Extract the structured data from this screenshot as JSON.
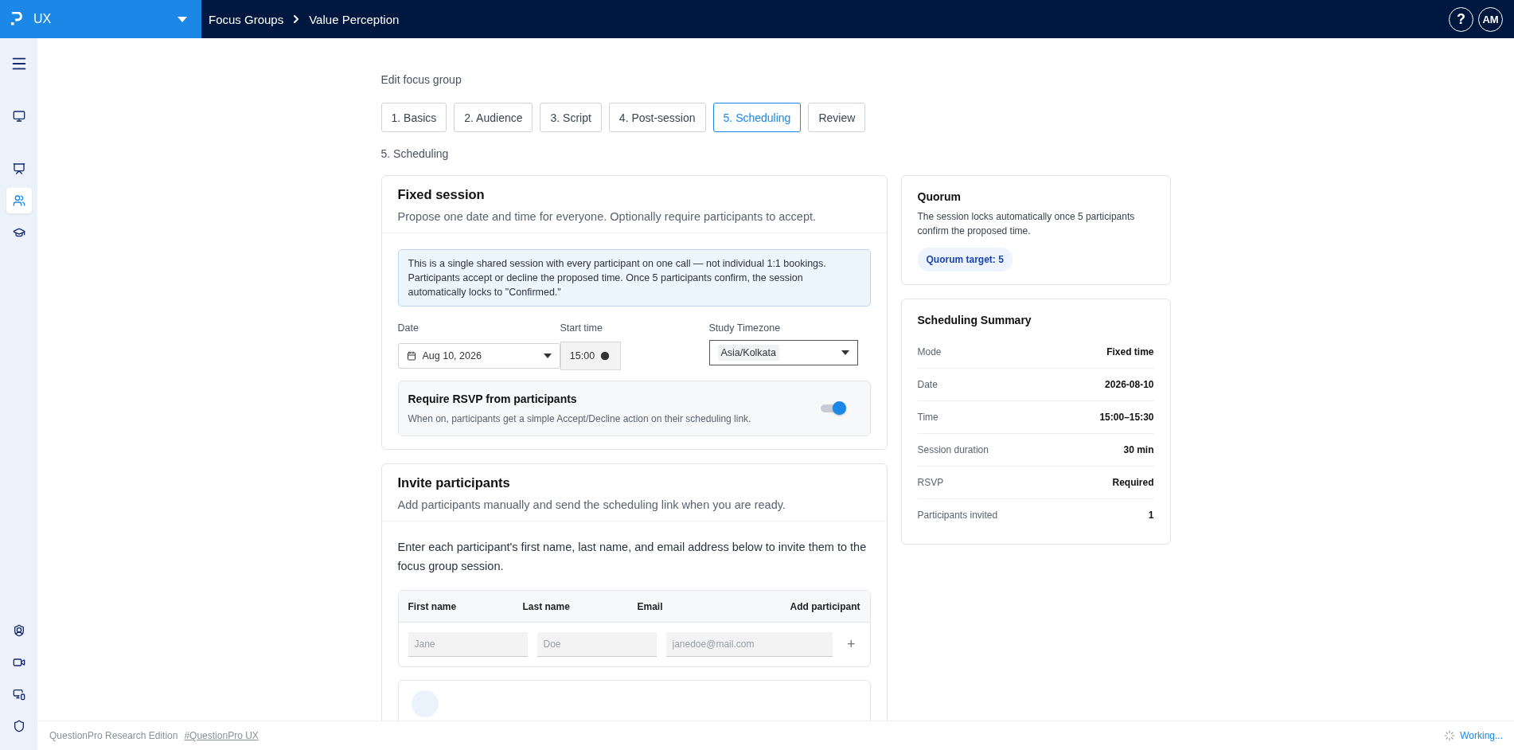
{
  "top_bar": {
    "workspace": "UX",
    "breadcrumb": [
      "Focus Groups",
      "Value Perception"
    ],
    "avatar": "AM",
    "help": "?"
  },
  "sidebar": {
    "items": [
      {
        "selected": false
      },
      {
        "selected": false
      },
      {
        "selected": true
      },
      {
        "selected": false
      }
    ],
    "bottom_items": [
      {
        "selected": false
      },
      {
        "selected": false
      },
      {
        "selected": false
      },
      {
        "selected": false
      }
    ]
  },
  "page_title": "Edit focus group",
  "steps": [
    {
      "label": "1. Basics",
      "selected": false
    },
    {
      "label": "2. Audience",
      "selected": false
    },
    {
      "label": "3. Script",
      "selected": false
    },
    {
      "label": "4. Post-session",
      "selected": false
    },
    {
      "label": "5. Scheduling",
      "selected": true
    },
    {
      "label": "Review",
      "selected": false
    }
  ],
  "section_title": "5. Scheduling",
  "fixed_session": {
    "title": "Fixed session",
    "subtitle": "Propose one date and time for everyone. Optionally require participants to accept.",
    "notice": "This is a single shared session with every participant on one call — not individual 1:1 bookings. Participants accept or decline the proposed time. Once 5 participants confirm, the session automatically locks to \"Confirmed.\"",
    "date": {
      "label": "Date",
      "value": "Aug 10, 2026"
    },
    "start_time": {
      "label": "Start time",
      "value": "15:00"
    },
    "timezone": {
      "label": "Study Timezone",
      "value": "Asia/Kolkata"
    },
    "rsvp": {
      "title": "Require RSVP from participants",
      "description": "When on, participants get a simple Accept/Decline action on their scheduling link.",
      "on": true
    }
  },
  "invite": {
    "title": "Invite participants",
    "subtitle": "Add participants manually and send the scheduling link when you are ready.",
    "instructions": "Enter each participant's first name, last name, and email address below to invite them to the focus group session.",
    "columns": [
      "First name",
      "Last name",
      "Email",
      "Add participant"
    ],
    "placeholders": [
      "Jane",
      "Doe",
      "janedoe@mail.com"
    ],
    "add": "+"
  },
  "quorum": {
    "title": "Quorum",
    "text": "The session locks automatically once 5 participants confirm the proposed time.",
    "badge": "Quorum target: 5"
  },
  "summary": {
    "title": "Scheduling Summary",
    "rows": [
      {
        "label": "Mode",
        "value": "Fixed time"
      },
      {
        "label": "Date",
        "value": "2026-08-10"
      },
      {
        "label": "Time",
        "value": "15:00–15:30"
      },
      {
        "label": "Session duration",
        "value": "30 min"
      },
      {
        "label": "RSVP",
        "value": "Required"
      },
      {
        "label": "Participants invited",
        "value": "1"
      }
    ]
  },
  "footer": {
    "edition": "QuestionPro Research Edition",
    "link": "#QuestionPro UX",
    "status": "Working..."
  }
}
